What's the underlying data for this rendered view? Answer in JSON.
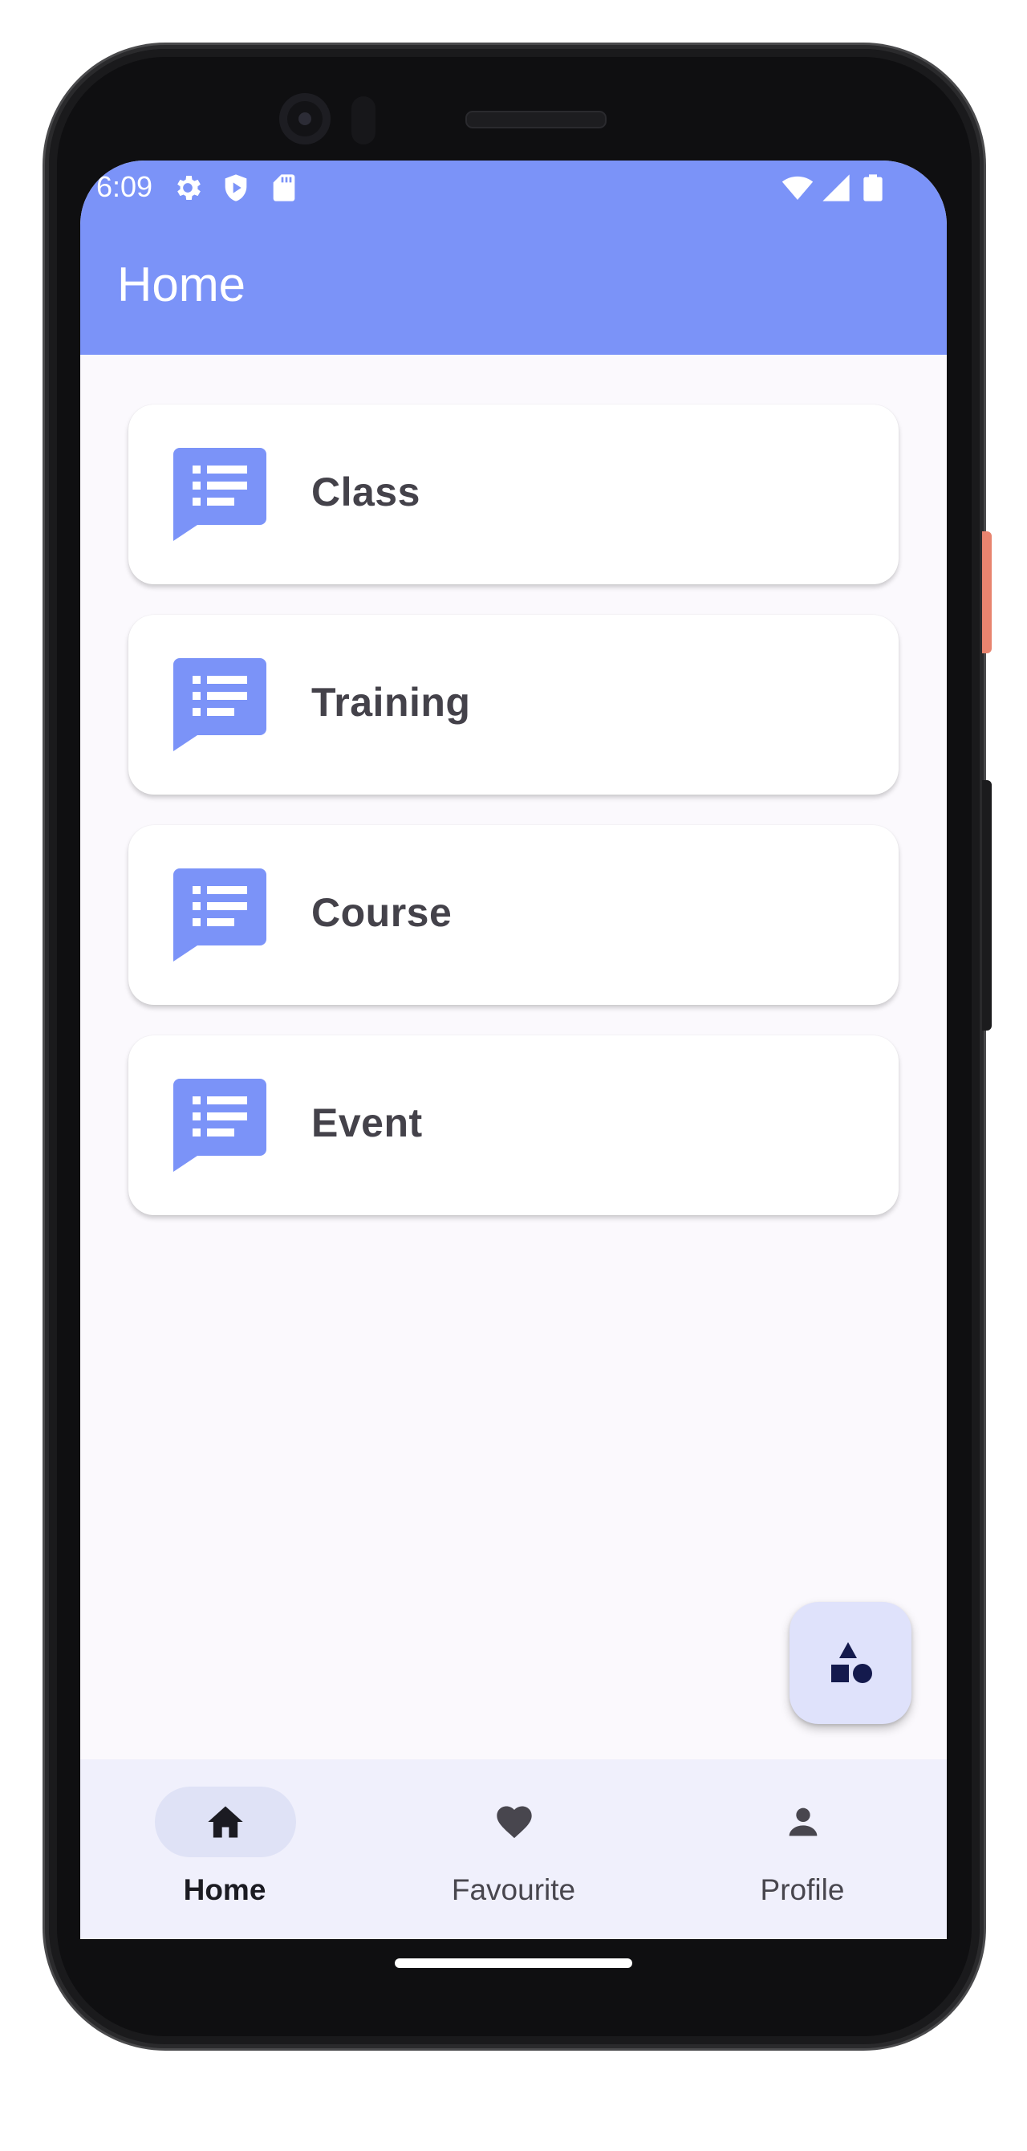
{
  "status_bar": {
    "time": "6:09",
    "left_icons": [
      "gear-icon",
      "shield-play-icon",
      "sd-card-icon"
    ],
    "right_icons": [
      "wifi-icon",
      "cellular-signal-icon",
      "battery-icon"
    ]
  },
  "app_bar": {
    "title": "Home",
    "color": "#7b93f8"
  },
  "menu": {
    "items": [
      {
        "label": "Class",
        "icon": "list-chat-icon"
      },
      {
        "label": "Training",
        "icon": "list-chat-icon"
      },
      {
        "label": "Course",
        "icon": "list-chat-icon"
      },
      {
        "label": "Event",
        "icon": "list-chat-icon"
      }
    ],
    "icon_color": "#7b93f8"
  },
  "fab": {
    "icon": "shapes-icon"
  },
  "bottom_nav": {
    "items": [
      {
        "label": "Home",
        "icon": "home-icon",
        "active": true
      },
      {
        "label": "Favourite",
        "icon": "heart-icon",
        "active": false
      },
      {
        "label": "Profile",
        "icon": "person-icon",
        "active": false
      }
    ]
  }
}
